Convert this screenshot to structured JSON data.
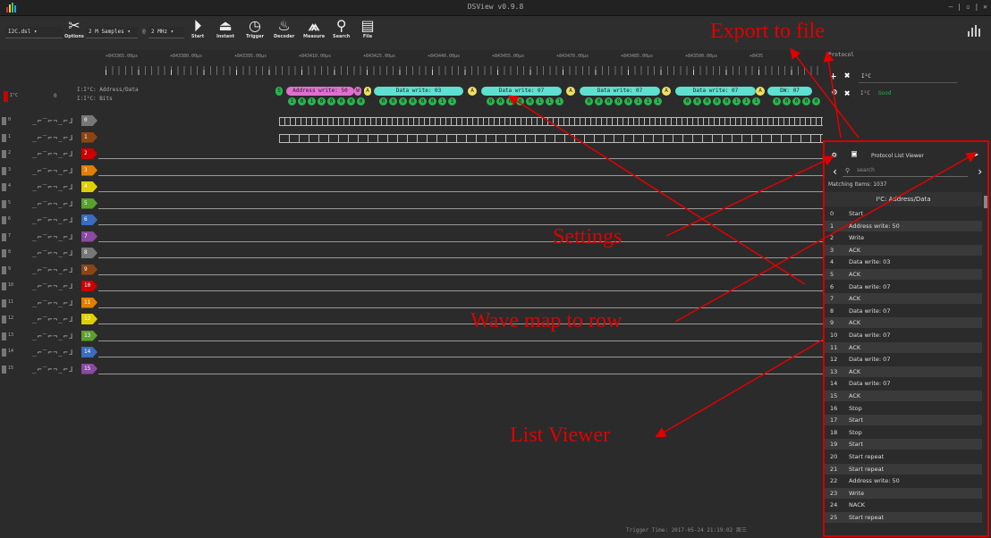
{
  "window": {
    "title": "DSView v0.9.8"
  },
  "toolbar": {
    "device": "I2C.dsl",
    "samples": "2 M Samples",
    "at": "@",
    "rate": "2 MHz",
    "options": "Options",
    "start": "Start",
    "instant": "Instant",
    "trigger": "Trigger",
    "decoder": "Decoder",
    "measure": "Measure",
    "search": "Search",
    "file": "File"
  },
  "ruler": {
    "ticks": [
      "+843365.00µs",
      "+843380.00µs",
      "+843395.00µs",
      "+843410.00µs",
      "+843425.00µs",
      "+843440.00µs",
      "+843455.00µs",
      "+843470.00µs",
      "+843485.00µs",
      "+843500.00µs",
      "+8435"
    ]
  },
  "protocol_panel": {
    "title": "Protocol",
    "decoder": "I²C",
    "decoder2": "I²C",
    "status": "Good"
  },
  "decoder_row": {
    "name": "I²C",
    "range": "0",
    "label1": "I:I²C: Address/Data",
    "label2": "I:I²C: Bits",
    "annotations": [
      "S",
      "Address write: 50",
      "W",
      "A",
      "Data write: 03",
      "A",
      "Data write: 07",
      "A",
      "Data write: 07",
      "A",
      "Data write: 07",
      "A",
      "DW: 07"
    ],
    "bits": [
      [
        "1",
        "0",
        "1",
        "0",
        "0",
        "0",
        "0",
        "0"
      ],
      [
        "0",
        "0",
        "0",
        "0",
        "0",
        "0",
        "1",
        "1"
      ],
      [
        "0",
        "0",
        "0",
        "0",
        "0",
        "1",
        "1",
        "1"
      ],
      [
        "0",
        "0",
        "0",
        "0",
        "0",
        "1",
        "1",
        "1"
      ],
      [
        "0",
        "0",
        "0",
        "0",
        "0",
        "1",
        "1",
        "1"
      ],
      [
        "0",
        "0",
        "0",
        "0",
        "0"
      ]
    ]
  },
  "channels": [
    {
      "num": "0",
      "tag": "0",
      "color": "#777777"
    },
    {
      "num": "1",
      "tag": "1",
      "color": "#8b4513"
    },
    {
      "num": "2",
      "tag": "2",
      "color": "#cc0000"
    },
    {
      "num": "3",
      "tag": "3",
      "color": "#e08000"
    },
    {
      "num": "4",
      "tag": "4",
      "color": "#e0d000"
    },
    {
      "num": "5",
      "tag": "5",
      "color": "#5aa02c"
    },
    {
      "num": "6",
      "tag": "6",
      "color": "#3a6cc0"
    },
    {
      "num": "7",
      "tag": "7",
      "color": "#8a4aa0"
    },
    {
      "num": "8",
      "tag": "8",
      "color": "#777777"
    },
    {
      "num": "9",
      "tag": "9",
      "color": "#8b4513"
    },
    {
      "num": "10",
      "tag": "10",
      "color": "#cc0000"
    },
    {
      "num": "11",
      "tag": "11",
      "color": "#e08000"
    },
    {
      "num": "12",
      "tag": "12",
      "color": "#e0d000"
    },
    {
      "num": "13",
      "tag": "13",
      "color": "#5aa02c"
    },
    {
      "num": "14",
      "tag": "14",
      "color": "#3a6cc0"
    },
    {
      "num": "15",
      "tag": "15",
      "color": "#8a4aa0"
    }
  ],
  "edge_glyphs": "_⌐‾⌐¬_⌐ɺ",
  "list_viewer": {
    "title": "Protocol List Viewer",
    "search_placeholder": "search",
    "matching_label": "Matching Items:",
    "matching_count": "1037",
    "column": "I²C: Address/Data",
    "rows": [
      [
        "0",
        "Start"
      ],
      [
        "1",
        "Address write: 50"
      ],
      [
        "2",
        "Write"
      ],
      [
        "3",
        "ACK"
      ],
      [
        "4",
        "Data write: 03"
      ],
      [
        "5",
        "ACK"
      ],
      [
        "6",
        "Data write: 07"
      ],
      [
        "7",
        "ACK"
      ],
      [
        "8",
        "Data write: 07"
      ],
      [
        "9",
        "ACK"
      ],
      [
        "10",
        "Data write: 07"
      ],
      [
        "11",
        "ACK"
      ],
      [
        "12",
        "Data write: 07"
      ],
      [
        "13",
        "ACK"
      ],
      [
        "14",
        "Data write: 07"
      ],
      [
        "15",
        "ACK"
      ],
      [
        "16",
        "Stop"
      ],
      [
        "17",
        "Start"
      ],
      [
        "18",
        "Stop"
      ],
      [
        "19",
        "Start"
      ],
      [
        "20",
        "Start repeat"
      ],
      [
        "21",
        "Start repeat"
      ],
      [
        "22",
        "Address write: 50"
      ],
      [
        "23",
        "Write"
      ],
      [
        "24",
        "NACK"
      ],
      [
        "25",
        "Start repeat"
      ]
    ]
  },
  "status": {
    "trigger_time": "Trigger Time: 2017-05-24 21:19:02 周三"
  },
  "annotations": {
    "export": "Export to file",
    "settings": "Settings",
    "wavemap": "Wave map to row",
    "listviewer": "List Viewer"
  }
}
